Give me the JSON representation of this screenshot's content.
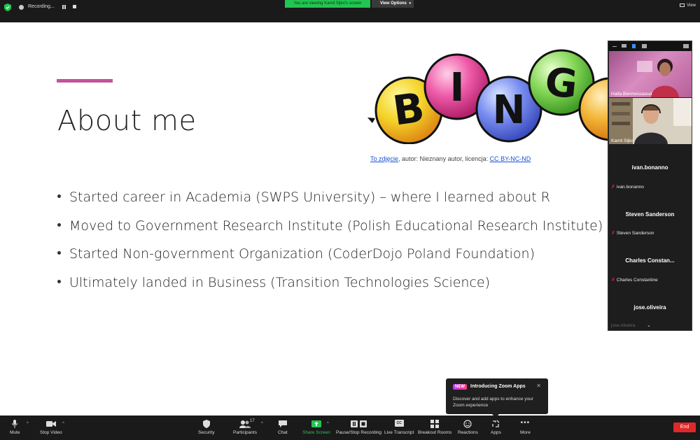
{
  "topbar": {
    "recording_label": "Recording...",
    "viewing_banner": "You are viewing Kamil Sijko's screen",
    "view_options_label": "View Options",
    "view_label": "View"
  },
  "slide": {
    "title": "About me",
    "bullets": [
      "Started career in Academia (SWPS University) – where I learned about R",
      "Moved to Government Research Institute (Polish Educational Research Institute)",
      "Started Non-government Organization (CoderDojo Poland Foundation)",
      "Ultimately landed in Business (Transition Technologies Science)"
    ],
    "image_letters": [
      "B",
      "I",
      "N",
      "G"
    ],
    "caption": {
      "link1": "To zdjęcie",
      "middle": ", autor: Nieznany autor, licencja: ",
      "link2": "CC BY-NC-ND"
    },
    "accent_color": "#c2549a"
  },
  "gallery": {
    "tiles": [
      {
        "label": "Haifa Benmessaoud"
      },
      {
        "label": "Kamil Sijko"
      }
    ],
    "participants": [
      {
        "name": "ivan.bonanno",
        "small": "ivan.bonanno"
      },
      {
        "name": "Steven Sanderson",
        "small": "Steven Sanderson"
      },
      {
        "name": "Charles  Constan...",
        "small": "Charles Constantine"
      },
      {
        "name": "jose.oliveira",
        "small": "jose.oliveira"
      }
    ]
  },
  "toast": {
    "badge": "NEW",
    "title": "Introducing Zoom Apps",
    "body": "Discover and add apps to enhance your Zoom experience"
  },
  "toolbar": {
    "mute": "Mute",
    "stop_video": "Stop Video",
    "security": "Security",
    "participants": "Participants",
    "participants_count": "17",
    "chat": "Chat",
    "share_screen": "Share Screen",
    "recording": "Pause/Stop Recording",
    "transcript": "Live Transcript",
    "transcript_icon": "CC",
    "breakout": "Breakout Rooms",
    "reactions": "Reactions",
    "apps": "Apps",
    "more": "More",
    "end": "End"
  }
}
